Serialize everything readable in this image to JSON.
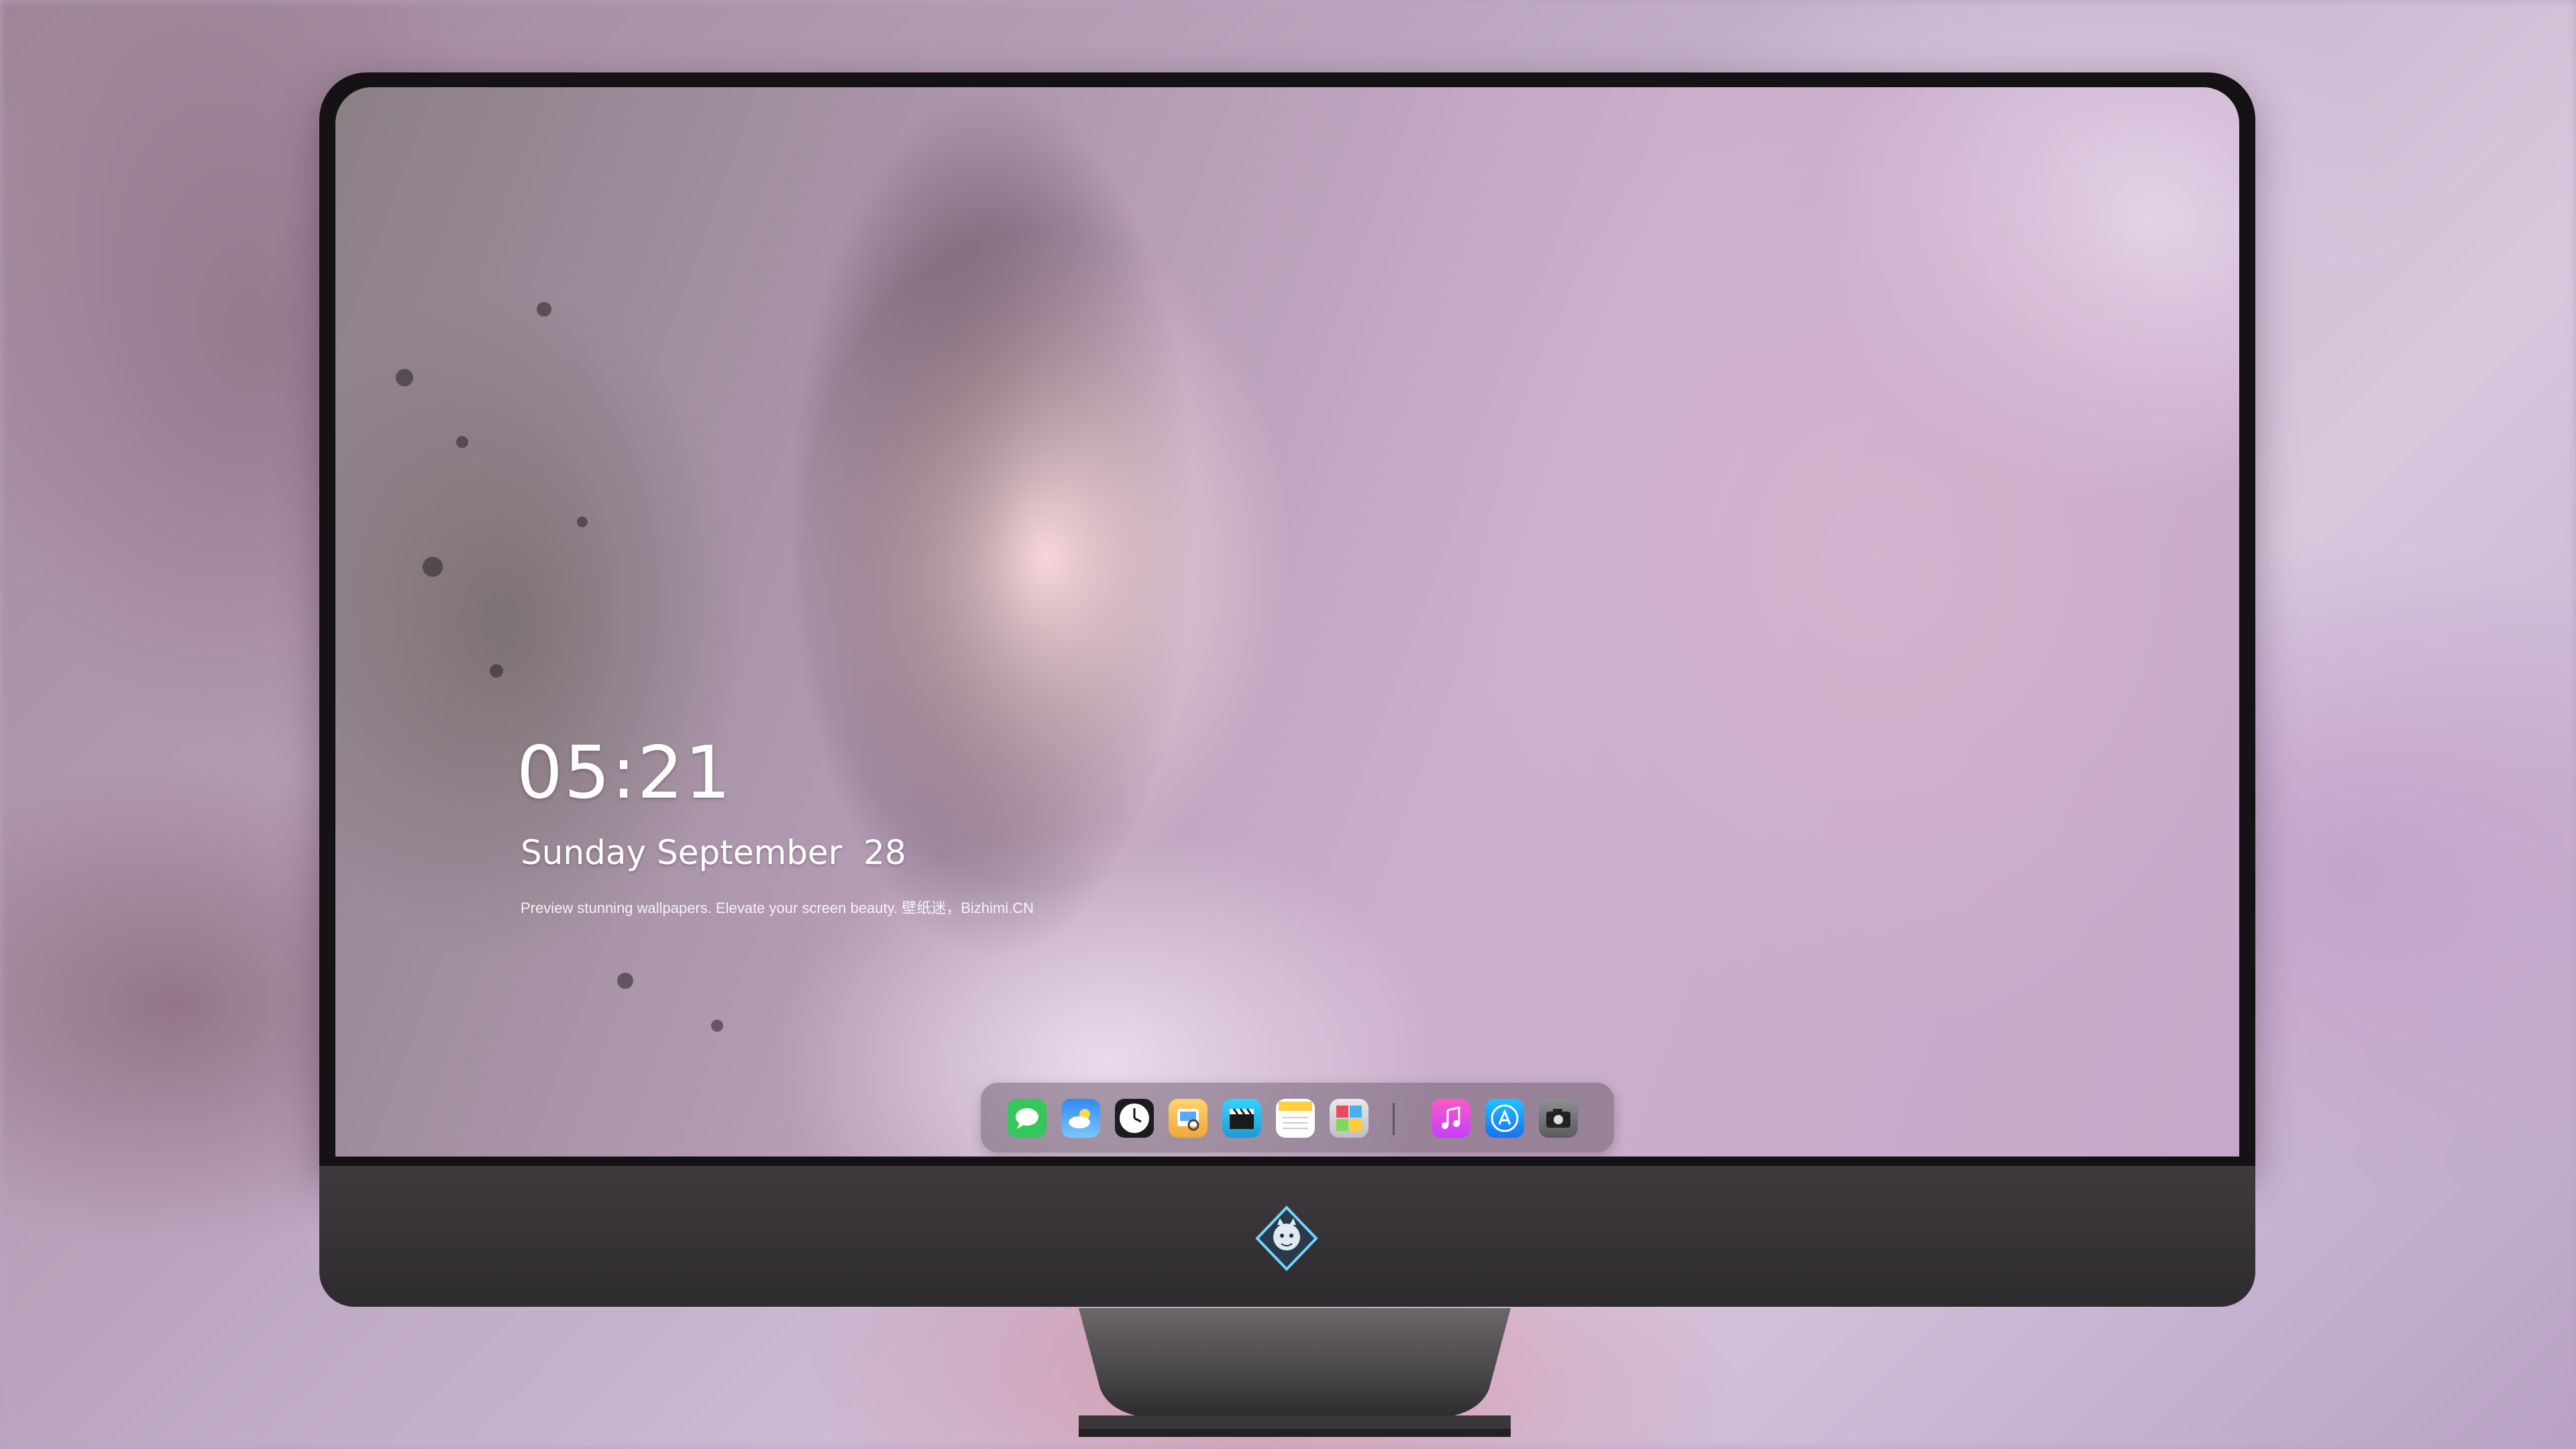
{
  "lock_screen": {
    "time": "05:21",
    "date": "Sunday September  28",
    "tagline": "Preview stunning wallpapers. Elevate your screen beauty. 壁纸迷，Bizhimi.CN"
  },
  "dock": {
    "apps": [
      {
        "name": "Messages",
        "icon": "messages-icon"
      },
      {
        "name": "Weather",
        "icon": "weather-icon"
      },
      {
        "name": "Clock",
        "icon": "clock-icon"
      },
      {
        "name": "Preview",
        "icon": "preview-icon"
      },
      {
        "name": "Final Cut",
        "icon": "clapperboard-icon"
      },
      {
        "name": "Notes",
        "icon": "notes-icon"
      },
      {
        "name": "Photo Booth",
        "icon": "photo-booth-icon"
      },
      {
        "name": "Music",
        "icon": "music-icon"
      },
      {
        "name": "App Store",
        "icon": "app-store-icon"
      },
      {
        "name": "Camera",
        "icon": "camera-icon"
      }
    ]
  },
  "colors": {
    "bezel": "#141214",
    "chin": "#3a363a",
    "dock_bg": "#5a4e5a",
    "text": "#ffffff"
  }
}
